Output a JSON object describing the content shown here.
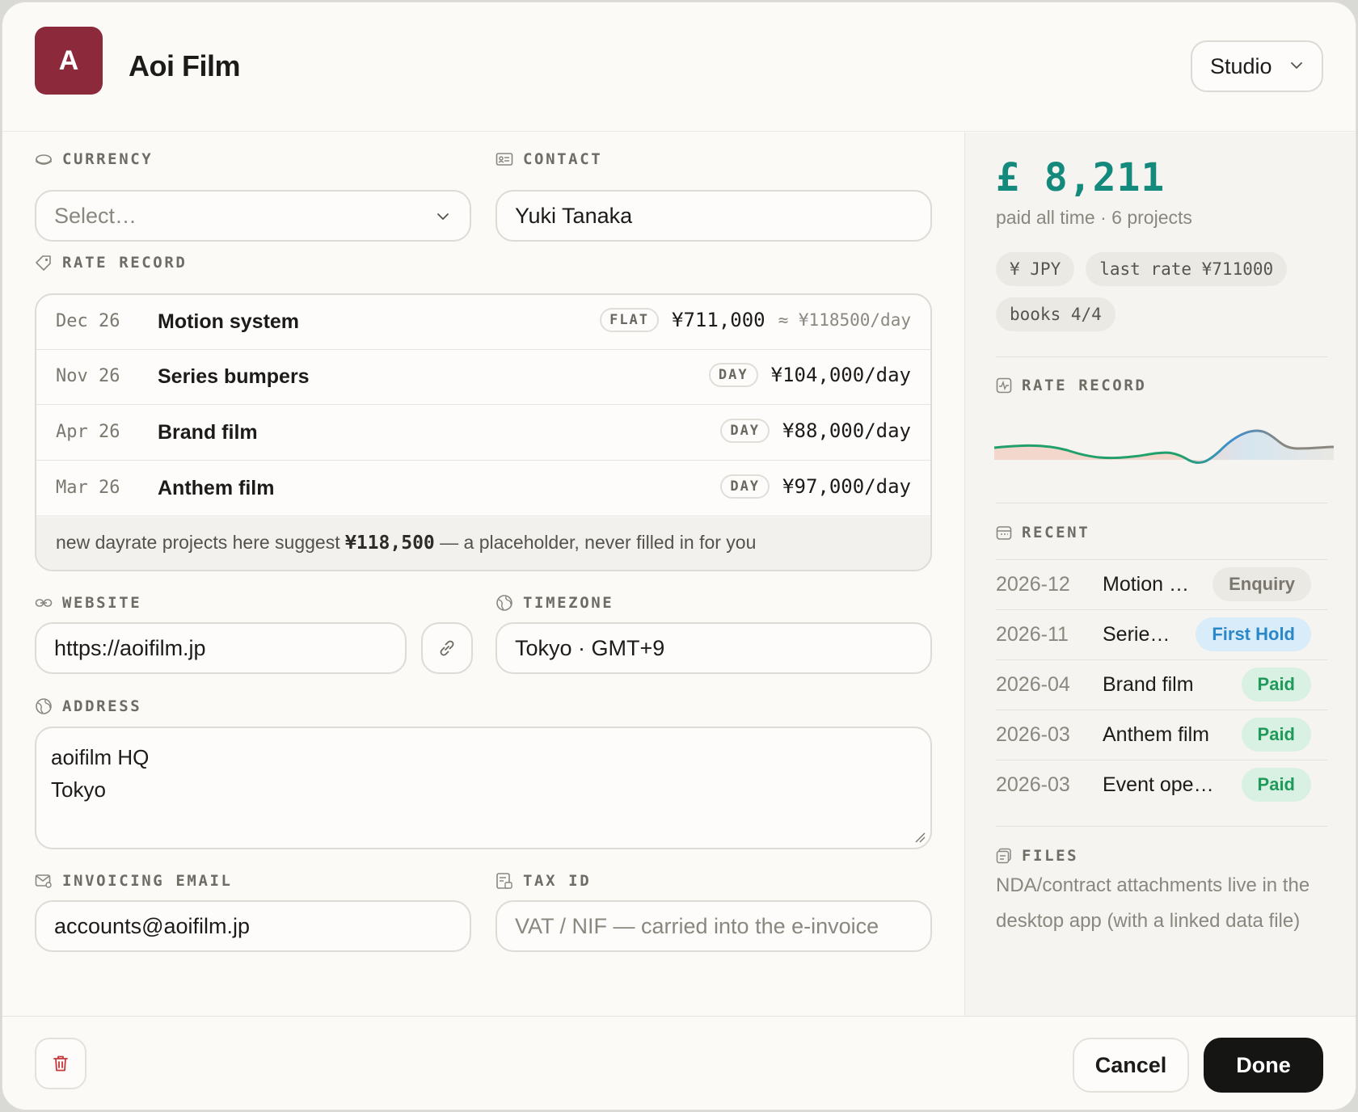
{
  "header": {
    "avatar_letter": "A",
    "client_name": "Aoi Film",
    "type_select": "Studio"
  },
  "form": {
    "currency": {
      "label": "CURRENCY",
      "placeholder": "Select…"
    },
    "contact": {
      "label": "CONTACT",
      "value": "Yuki Tanaka"
    },
    "rate_record": {
      "label": "RATE RECORD",
      "rows": [
        {
          "date": "Dec 26",
          "project": "Motion system",
          "kind": "FLAT",
          "rate": "¥711,000",
          "approx": "≈ ¥118500/day"
        },
        {
          "date": "Nov 26",
          "project": "Series bumpers",
          "kind": "DAY",
          "rate": "¥104,000/day",
          "approx": ""
        },
        {
          "date": "Apr 26",
          "project": "Brand film",
          "kind": "DAY",
          "rate": "¥88,000/day",
          "approx": ""
        },
        {
          "date": "Mar 26",
          "project": "Anthem film",
          "kind": "DAY",
          "rate": "¥97,000/day",
          "approx": ""
        }
      ],
      "note_prefix": "new dayrate projects here suggest ",
      "note_value": "¥118,500",
      "note_suffix": " — a placeholder, never filled in for you"
    },
    "website": {
      "label": "WEBSITE",
      "value": "https://aoifilm.jp"
    },
    "timezone": {
      "label": "TIMEZONE",
      "value": "Tokyo · GMT+9"
    },
    "address": {
      "label": "ADDRESS",
      "line1": "aoifilm HQ",
      "line2": "Tokyo"
    },
    "invoicing_email": {
      "label": "INVOICING EMAIL",
      "value": "accounts@aoifilm.jp"
    },
    "tax_id": {
      "label": "TAX ID",
      "placeholder": "VAT / NIF — carried into the e-invoice"
    }
  },
  "summary": {
    "total": "£ 8,211",
    "total_sub": "paid all time · 6 projects",
    "chips": [
      "¥ JPY",
      "last rate ¥711000",
      "books 4/4"
    ],
    "rate_record_label": "RATE RECORD",
    "recent_label": "RECENT",
    "recent": [
      {
        "date": "2026-12",
        "title": "Motion …",
        "status": "Enquiry",
        "kind": "enquiry"
      },
      {
        "date": "2026-11",
        "title": "Serie…",
        "status": "First Hold",
        "kind": "hold"
      },
      {
        "date": "2026-04",
        "title": "Brand film",
        "status": "Paid",
        "kind": "paid"
      },
      {
        "date": "2026-03",
        "title": "Anthem film",
        "status": "Paid",
        "kind": "paid"
      },
      {
        "date": "2026-03",
        "title": "Event ope…",
        "status": "Paid",
        "kind": "paid"
      }
    ],
    "files_label": "FILES",
    "files_text": "NDA/contract attachments live in the desktop app (with a linked data file)"
  },
  "footer": {
    "cancel": "Cancel",
    "done": "Done"
  },
  "colors": {
    "avatar": "#8c2a3b",
    "total": "#138a7c",
    "done_bg": "#151514",
    "status_paid": "#1f9a5a",
    "status_hold": "#2a88c9"
  },
  "icons": [
    "chevron-down-icon",
    "currency-icon",
    "contact-card-icon",
    "tag-icon",
    "link-icon",
    "globe-icon",
    "mail-icon",
    "receipt-icon",
    "pulse-icon",
    "calendar-icon",
    "files-icon",
    "trash-icon"
  ]
}
